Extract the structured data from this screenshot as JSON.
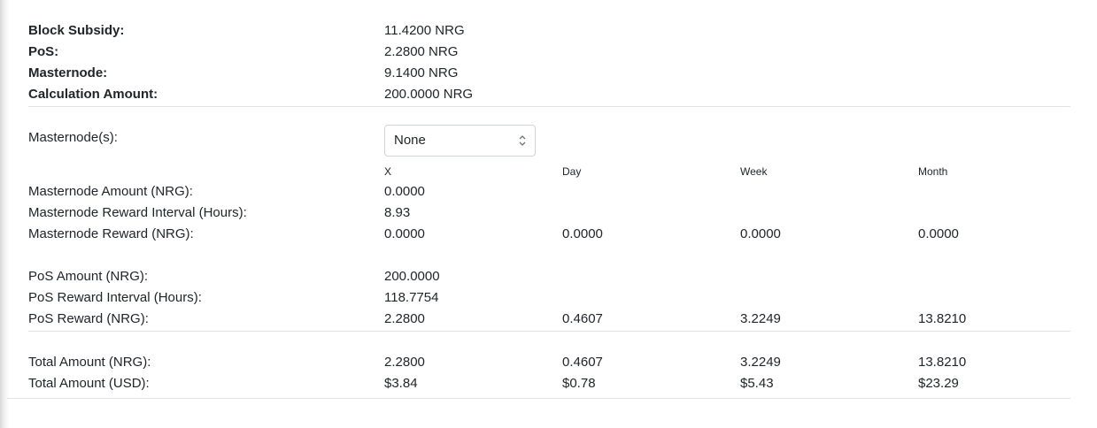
{
  "summary": {
    "block_subsidy": {
      "label": "Block Subsidy:",
      "value": "11.4200 NRG"
    },
    "pos": {
      "label": "PoS:",
      "value": "2.2800 NRG"
    },
    "masternode": {
      "label": "Masternode:",
      "value": "9.1400 NRG"
    },
    "calculation_amount": {
      "label": "Calculation Amount:",
      "value": "200.0000 NRG"
    }
  },
  "masternode_select": {
    "label": "Masternode(s):",
    "selected": "None"
  },
  "columns": {
    "x": "X",
    "day": "Day",
    "week": "Week",
    "month": "Month"
  },
  "masternode_rows": {
    "amount": {
      "label": "Masternode Amount (NRG):",
      "x": "0.0000"
    },
    "interval": {
      "label": "Masternode Reward Interval (Hours):",
      "x": "8.93"
    },
    "reward": {
      "label": "Masternode Reward (NRG):",
      "x": "0.0000",
      "day": "0.0000",
      "week": "0.0000",
      "month": "0.0000"
    }
  },
  "pos_rows": {
    "amount": {
      "label": "PoS Amount (NRG):",
      "x": "200.0000"
    },
    "interval": {
      "label": "PoS Reward Interval (Hours):",
      "x": "118.7754"
    },
    "reward": {
      "label": "PoS Reward (NRG):",
      "x": "2.2800",
      "day": "0.4607",
      "week": "3.2249",
      "month": "13.8210"
    }
  },
  "totals": {
    "nrg": {
      "label": "Total Amount (NRG):",
      "x": "2.2800",
      "day": "0.4607",
      "week": "3.2249",
      "month": "13.8210"
    },
    "usd": {
      "label": "Total Amount (USD):",
      "x": "$3.84",
      "day": "$0.78",
      "week": "$5.43",
      "month": "$23.29"
    }
  }
}
